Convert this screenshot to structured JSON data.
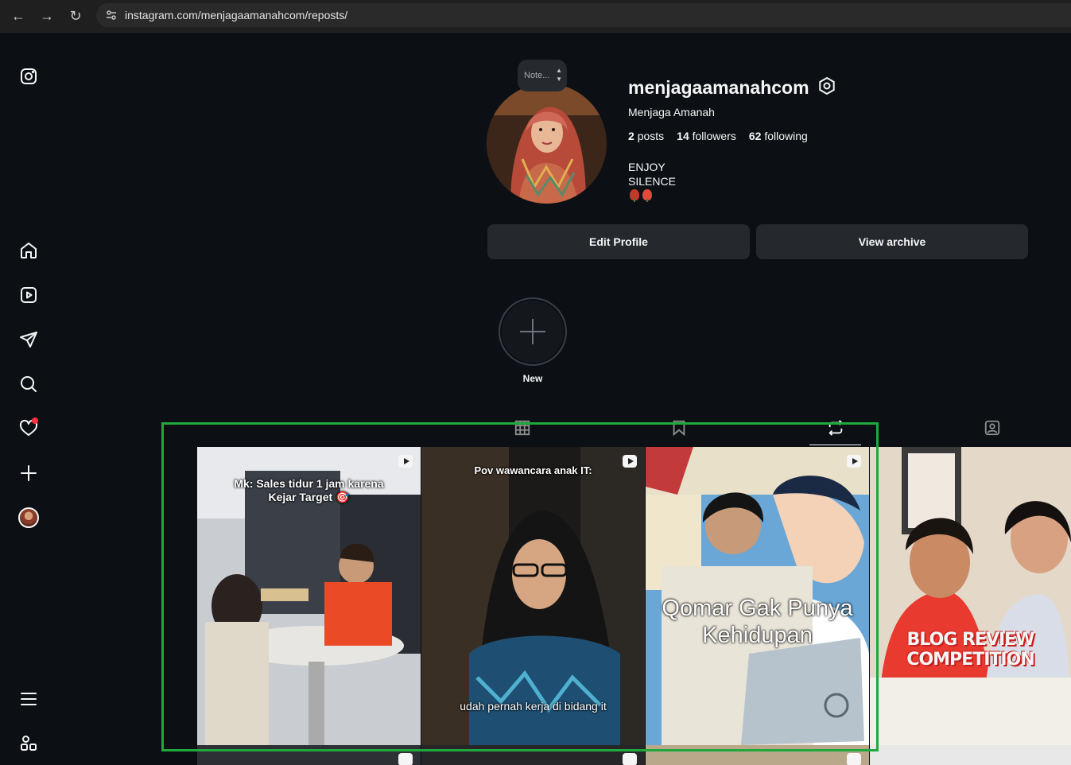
{
  "browser": {
    "url": "instagram.com/menjagaamanahcom/reposts/"
  },
  "sidebar": {
    "items": [
      {
        "name": "instagram-logo-icon"
      },
      {
        "name": "home-icon"
      },
      {
        "name": "reels-icon"
      },
      {
        "name": "direct-icon"
      },
      {
        "name": "search-icon"
      },
      {
        "name": "notifications-icon"
      },
      {
        "name": "create-icon"
      },
      {
        "name": "profile-avatar"
      },
      {
        "name": "menu-icon"
      },
      {
        "name": "also-from-meta-icon"
      }
    ]
  },
  "profile": {
    "note_placeholder": "Note...",
    "username": "menjagaamanahcom",
    "full_name": "Menjaga Amanah",
    "stats": {
      "posts_count": "2",
      "posts_label": "posts",
      "followers_count": "14",
      "followers_label": "followers",
      "following_count": "62",
      "following_label": "following"
    },
    "bio_line1": "ENJOY",
    "bio_line2": "SILENCE",
    "edit_profile_label": "Edit Profile",
    "view_archive_label": "View archive"
  },
  "highlights": {
    "new_label": "New"
  },
  "tabs": [
    {
      "name": "tab-posts",
      "active": false
    },
    {
      "name": "tab-saved",
      "active": false
    },
    {
      "name": "tab-reposts",
      "active": true
    },
    {
      "name": "tab-tagged",
      "active": false
    }
  ],
  "grid": {
    "tiles": [
      {
        "caption": "Mk: Sales tidur 1 jam karena\nKejar Target 🎯",
        "type": "reel"
      },
      {
        "caption_top": "Pov wawancara anak IT:",
        "caption_bottom": "udah pernah kerja di bidang it",
        "type": "reel"
      },
      {
        "caption": "Qomar Gak Punya\nKehidupan",
        "type": "reel"
      },
      {
        "caption": "BLOG REVIEW\nCOMPETITION",
        "type": "post"
      }
    ]
  },
  "colors": {
    "background": "#0c1014",
    "button": "#25292e",
    "highlight_box": "#1fa83c",
    "notification_dot": "#ff3040"
  }
}
